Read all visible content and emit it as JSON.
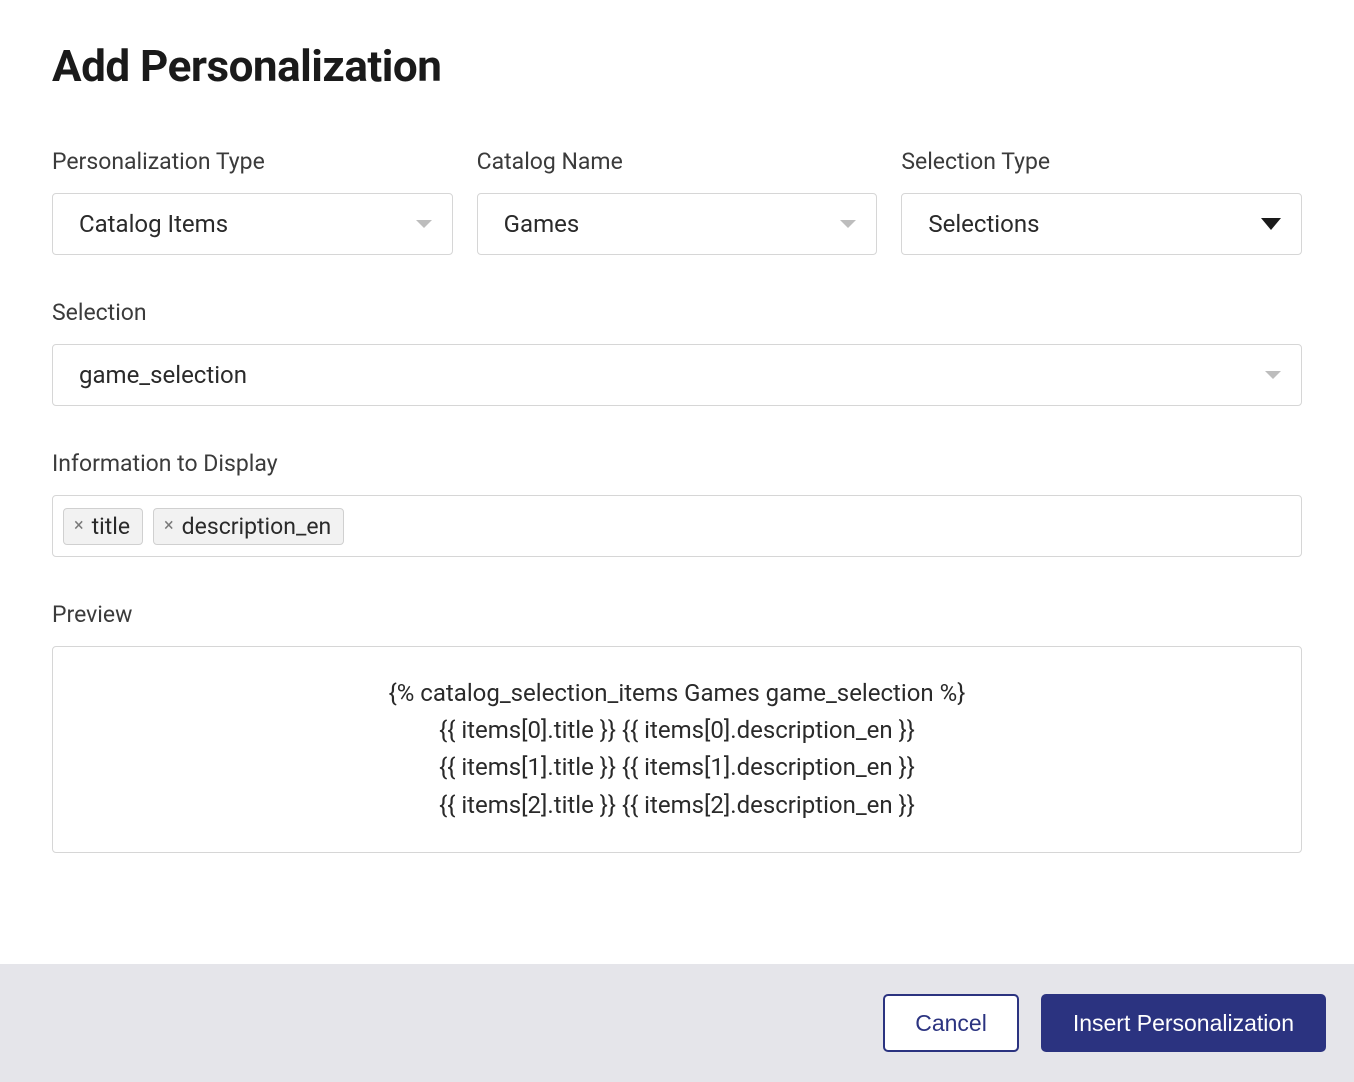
{
  "title": "Add Personalization",
  "fields": {
    "personalization_type": {
      "label": "Personalization Type",
      "value": "Catalog Items"
    },
    "catalog_name": {
      "label": "Catalog Name",
      "value": "Games"
    },
    "selection_type": {
      "label": "Selection Type",
      "value": "Selections"
    },
    "selection": {
      "label": "Selection",
      "value": "game_selection"
    },
    "info_to_display": {
      "label": "Information to Display",
      "tags": [
        "title",
        "description_en"
      ]
    },
    "preview": {
      "label": "Preview",
      "lines": [
        "{% catalog_selection_items Games game_selection %}",
        "{{ items[0].title }} {{ items[0].description_en }}",
        "{{ items[1].title }} {{ items[1].description_en }}",
        "{{ items[2].title }} {{ items[2].description_en }}"
      ]
    }
  },
  "footer": {
    "cancel": "Cancel",
    "insert": "Insert Personalization"
  }
}
